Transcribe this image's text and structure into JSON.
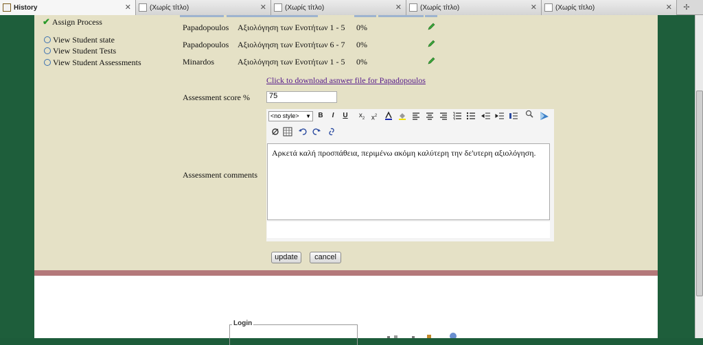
{
  "tabs": [
    {
      "label": "History",
      "close": "✕"
    },
    {
      "label": "(Χωρίς τίτλο)",
      "close": "✕"
    },
    {
      "label": "(Χωρίς τίτλο)",
      "close": "✕"
    },
    {
      "label": "(Χωρίς τίτλο)",
      "close": "✕"
    },
    {
      "label": "(Χωρίς τίτλο)",
      "close": "✕"
    }
  ],
  "sidebar": {
    "assign": "Assign Process",
    "items": [
      "View Student state",
      "View Student Tests",
      "View Student Assessments"
    ]
  },
  "rows": [
    {
      "name": "Papadopoulos",
      "units": "Αξιολόγηση των Ενοτήτων 1 - 5",
      "percent": "0%"
    },
    {
      "name": "Papadopoulos",
      "units": "Αξιολόγηση των Ενοτήτων 6 - 7",
      "percent": "0%"
    },
    {
      "name": "Minardos",
      "units": "Αξιολόγηση των Ενοτήτων 1 - 5",
      "percent": "0%"
    }
  ],
  "download_link": "Click to download asnwer file for Papadopoulos",
  "score": {
    "label": "Assessment score %",
    "value": "75"
  },
  "comments": {
    "label": "Assessment comments",
    "style_select": "<no style>",
    "text": "Αρκετά καλή προσπάθεια, περιμένω ακόμη καλύτερη την δε'υτερη αξιολόγηση."
  },
  "toolbar": {
    "bold": "B",
    "italic": "I",
    "underline": "U"
  },
  "buttons": {
    "update": "update",
    "cancel": "cancel"
  },
  "footer": {
    "login_legend": "Login"
  },
  "colors": {
    "page_green": "#1e5e3b",
    "content_bg": "#e5e1c6",
    "divider": "#b4787a",
    "link": "#551a8b"
  }
}
